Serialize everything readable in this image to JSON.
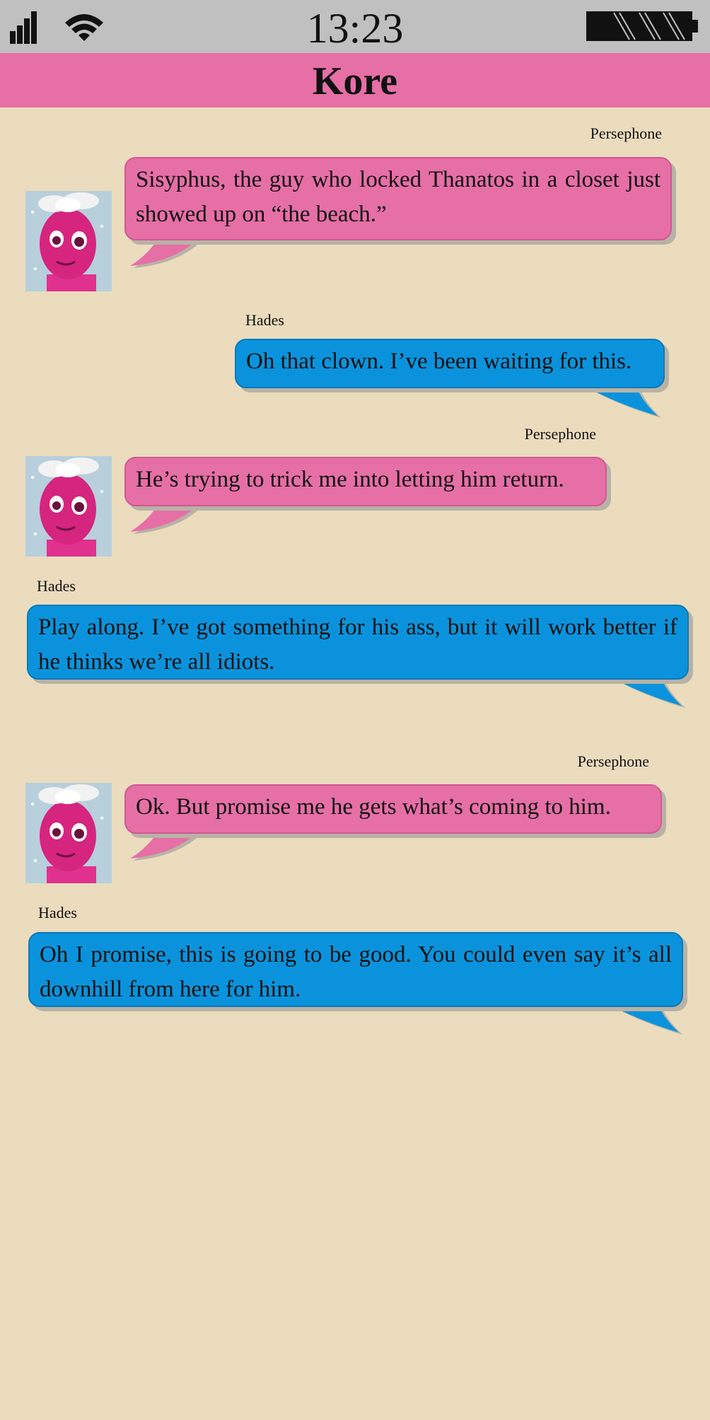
{
  "status": {
    "time": "13:23"
  },
  "header": {
    "title": "Kore"
  },
  "messages": [
    {
      "sender": "Persephone",
      "text": "Sisyphus, the guy who locked Thanatos in a closet just showed up on “the beach.”"
    },
    {
      "sender": "Hades",
      "text": "Oh that clown. I’ve been waiting for this."
    },
    {
      "sender": "Persephone",
      "text": "He’s trying to trick me into letting him return."
    },
    {
      "sender": "Hades",
      "text": "Play along. I’ve got something for his ass, but it will work better if he thinks we’re all idiots."
    },
    {
      "sender": "Persephone",
      "text": "Ok. But promise me he gets what’s coming to him."
    },
    {
      "sender": "Hades",
      "text": "Oh I promise, this is going to be good. You could even say it’s all downhill from here for him."
    }
  ],
  "icons": {
    "signal": "signal-icon",
    "wifi": "wifi-icon",
    "battery": "battery-icon",
    "avatar": "persephone-avatar"
  },
  "colors": {
    "persephone_bubble": "#e66fa6",
    "hades_bubble": "#0a93dc",
    "background": "#ebdcbe",
    "status_bar": "#c0c0c0"
  }
}
